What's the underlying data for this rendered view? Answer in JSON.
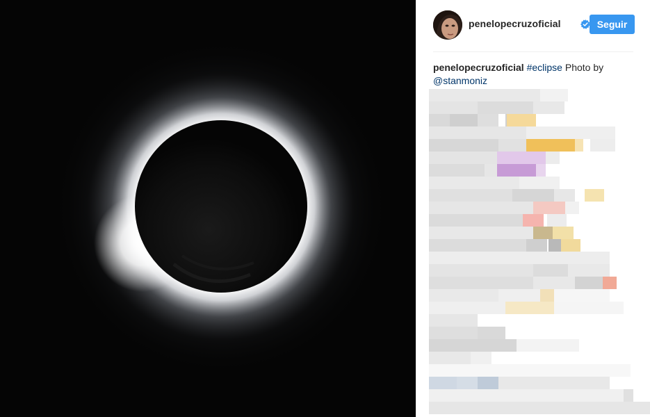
{
  "post": {
    "username": "penelopecruzoficial",
    "follow_label": "Seguir",
    "caption": {
      "username": "penelopecruzoficial",
      "hashtag": "#eclipse",
      "text": " Photo by ",
      "mention": "@stanmoniz"
    }
  },
  "comments": {
    "blurred": true
  },
  "colors": {
    "follow_button": "#3897f0",
    "verified_badge": "#3897f0",
    "link": "#003569",
    "text": "#262626"
  },
  "icons": {
    "verified": "verified-badge-icon",
    "avatar": "profile-avatar"
  }
}
